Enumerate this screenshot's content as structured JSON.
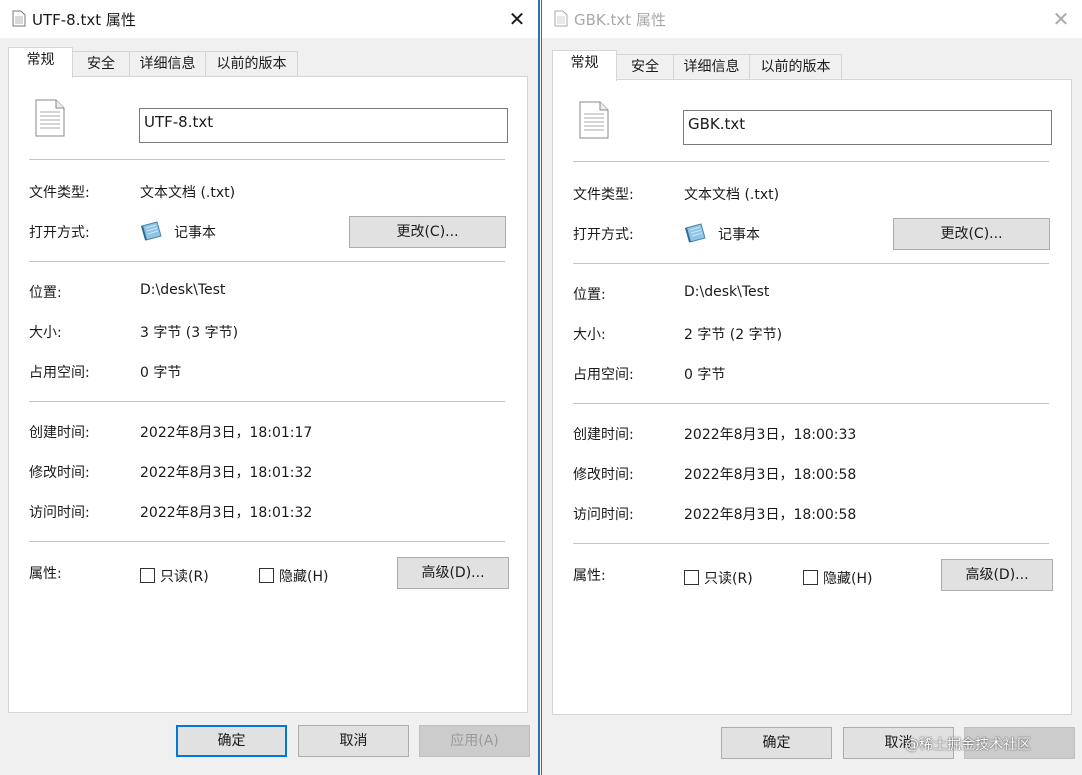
{
  "left": {
    "title": "UTF-8.txt 属性",
    "tabs": [
      "常规",
      "安全",
      "详细信息",
      "以前的版本"
    ],
    "file_name": "UTF-8.txt",
    "type_label": "文件类型:",
    "type_value": "文本文档 (.txt)",
    "open_label": "打开方式:",
    "open_app": "记事本",
    "change_button": "更改(C)...",
    "location_label": "位置:",
    "location_value": "D:\\desk\\Test",
    "size_label": "大小:",
    "size_value": "3 字节 (3 字节)",
    "disk_label": "占用空间:",
    "disk_value": "0 字节",
    "created_label": "创建时间:",
    "created_value": "2022年8月3日，18:01:17",
    "modified_label": "修改时间:",
    "modified_value": "2022年8月3日，18:01:32",
    "accessed_label": "访问时间:",
    "accessed_value": "2022年8月3日，18:01:32",
    "attr_label": "属性:",
    "readonly_label": "只读(R)",
    "hidden_label": "隐藏(H)",
    "advanced_button": "高级(D)...",
    "ok_button": "确定",
    "cancel_button": "取消",
    "apply_button": "应用(A)"
  },
  "right": {
    "title": "GBK.txt 属性",
    "tabs": [
      "常规",
      "安全",
      "详细信息",
      "以前的版本"
    ],
    "file_name": "GBK.txt",
    "type_label": "文件类型:",
    "type_value": "文本文档 (.txt)",
    "open_label": "打开方式:",
    "open_app": "记事本",
    "change_button": "更改(C)...",
    "location_label": "位置:",
    "location_value": "D:\\desk\\Test",
    "size_label": "大小:",
    "size_value": "2 字节 (2 字节)",
    "disk_label": "占用空间:",
    "disk_value": "0 字节",
    "created_label": "创建时间:",
    "created_value": "2022年8月3日，18:00:33",
    "modified_label": "修改时间:",
    "modified_value": "2022年8月3日，18:00:58",
    "accessed_label": "访问时间:",
    "accessed_value": "2022年8月3日，18:00:58",
    "attr_label": "属性:",
    "readonly_label": "只读(R)",
    "hidden_label": "隐藏(H)",
    "advanced_button": "高级(D)...",
    "ok_button": "确定",
    "cancel_button": "取消",
    "apply_button": "应用(A)"
  },
  "watermark": "@稀土掘金技术社区",
  "colors": {
    "accent": "#0078d7",
    "active_border": "#2b6fb6",
    "dialog_bg": "#f0f0f0"
  },
  "icons": [
    "text-file-icon",
    "notepad-icon",
    "close-icon"
  ]
}
